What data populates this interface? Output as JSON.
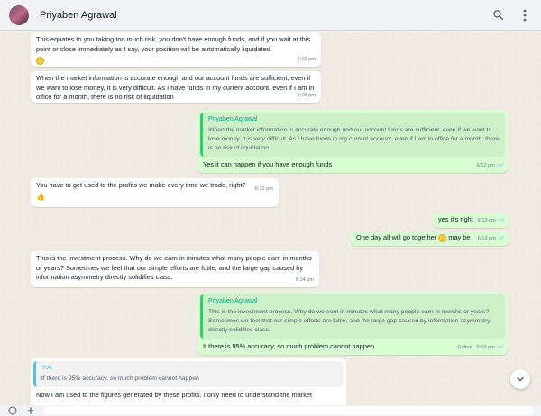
{
  "header": {
    "contact_name": "Priyaben Agrawal"
  },
  "icons": {
    "search": "search-icon",
    "menu": "kebab-menu-icon",
    "scroll": "chevron-down-icon",
    "emoji": "smiley-icon",
    "attach": "plus-icon"
  },
  "colors": {
    "incoming": "#ffffff",
    "outgoing": "#d9fdd3",
    "quote_accent": "#06a884",
    "read_ticks": "#53bdeb",
    "background": "#efeae2"
  },
  "messages": [
    {
      "dir": "in",
      "text": "This equates to you taking too much risk, you don't have enough funds, and if you wait at this point or close immediately as I say, your position will be automatically liquidated.",
      "time": "6:02 pm"
    },
    {
      "dir": "in",
      "text": "When the market information is accurate enough and our account funds are sufficient, even if we want to lose money, it is very difficult.  As I have funds in my current account, even if I am in office for a month, there is no risk of liquidation",
      "time": "6:03 pm"
    },
    {
      "dir": "out",
      "quote_name": "Priyaben Agrawal",
      "quote_text": "When the market information is accurate enough and our account funds are sufficient, even if we want to lose money, it is very difficult.  As I have funds in my current account, even if I am in office for a month, there is no risk of liquidation",
      "text": "Yes it can happen if you have enough funds",
      "time": "6:12 pm"
    },
    {
      "dir": "in",
      "text": "You have to get used to the profits we make every time we trade, right?",
      "time": "6:12 pm"
    },
    {
      "dir": "out",
      "text": "yes it's right",
      "time": "6:13 pm"
    },
    {
      "dir": "out",
      "text_before": "One day all will go together",
      "text_after": "may be",
      "time": "6:13 pm"
    },
    {
      "dir": "in",
      "text": "This is the investment process. Why do we earn in minutes what many people earn in months or years? Sometimes we feel that our simple efforts are futile, and the large gap caused by information asymmetry directly solidifies class.",
      "time": "6:14 pm"
    },
    {
      "dir": "out",
      "quote_name": "Priyaben Agrawal",
      "quote_text": "This is the investment process. Why do we earn in minutes what many people earn in months or years? Sometimes we feel that our simple efforts are futile, and the large gap caused by information asymmetry directly solidifies class.",
      "text": "If there is 95% accuracy, so much problem cannot happen",
      "edited": "Edited",
      "time": "6:16 pm"
    },
    {
      "dir": "in",
      "quote_name": "You",
      "quote_text": "If there is 95% accuracy, so much problem cannot happen",
      "text": "Now I am used to the figures generated by these profits. I only need to understand the market"
    }
  ]
}
